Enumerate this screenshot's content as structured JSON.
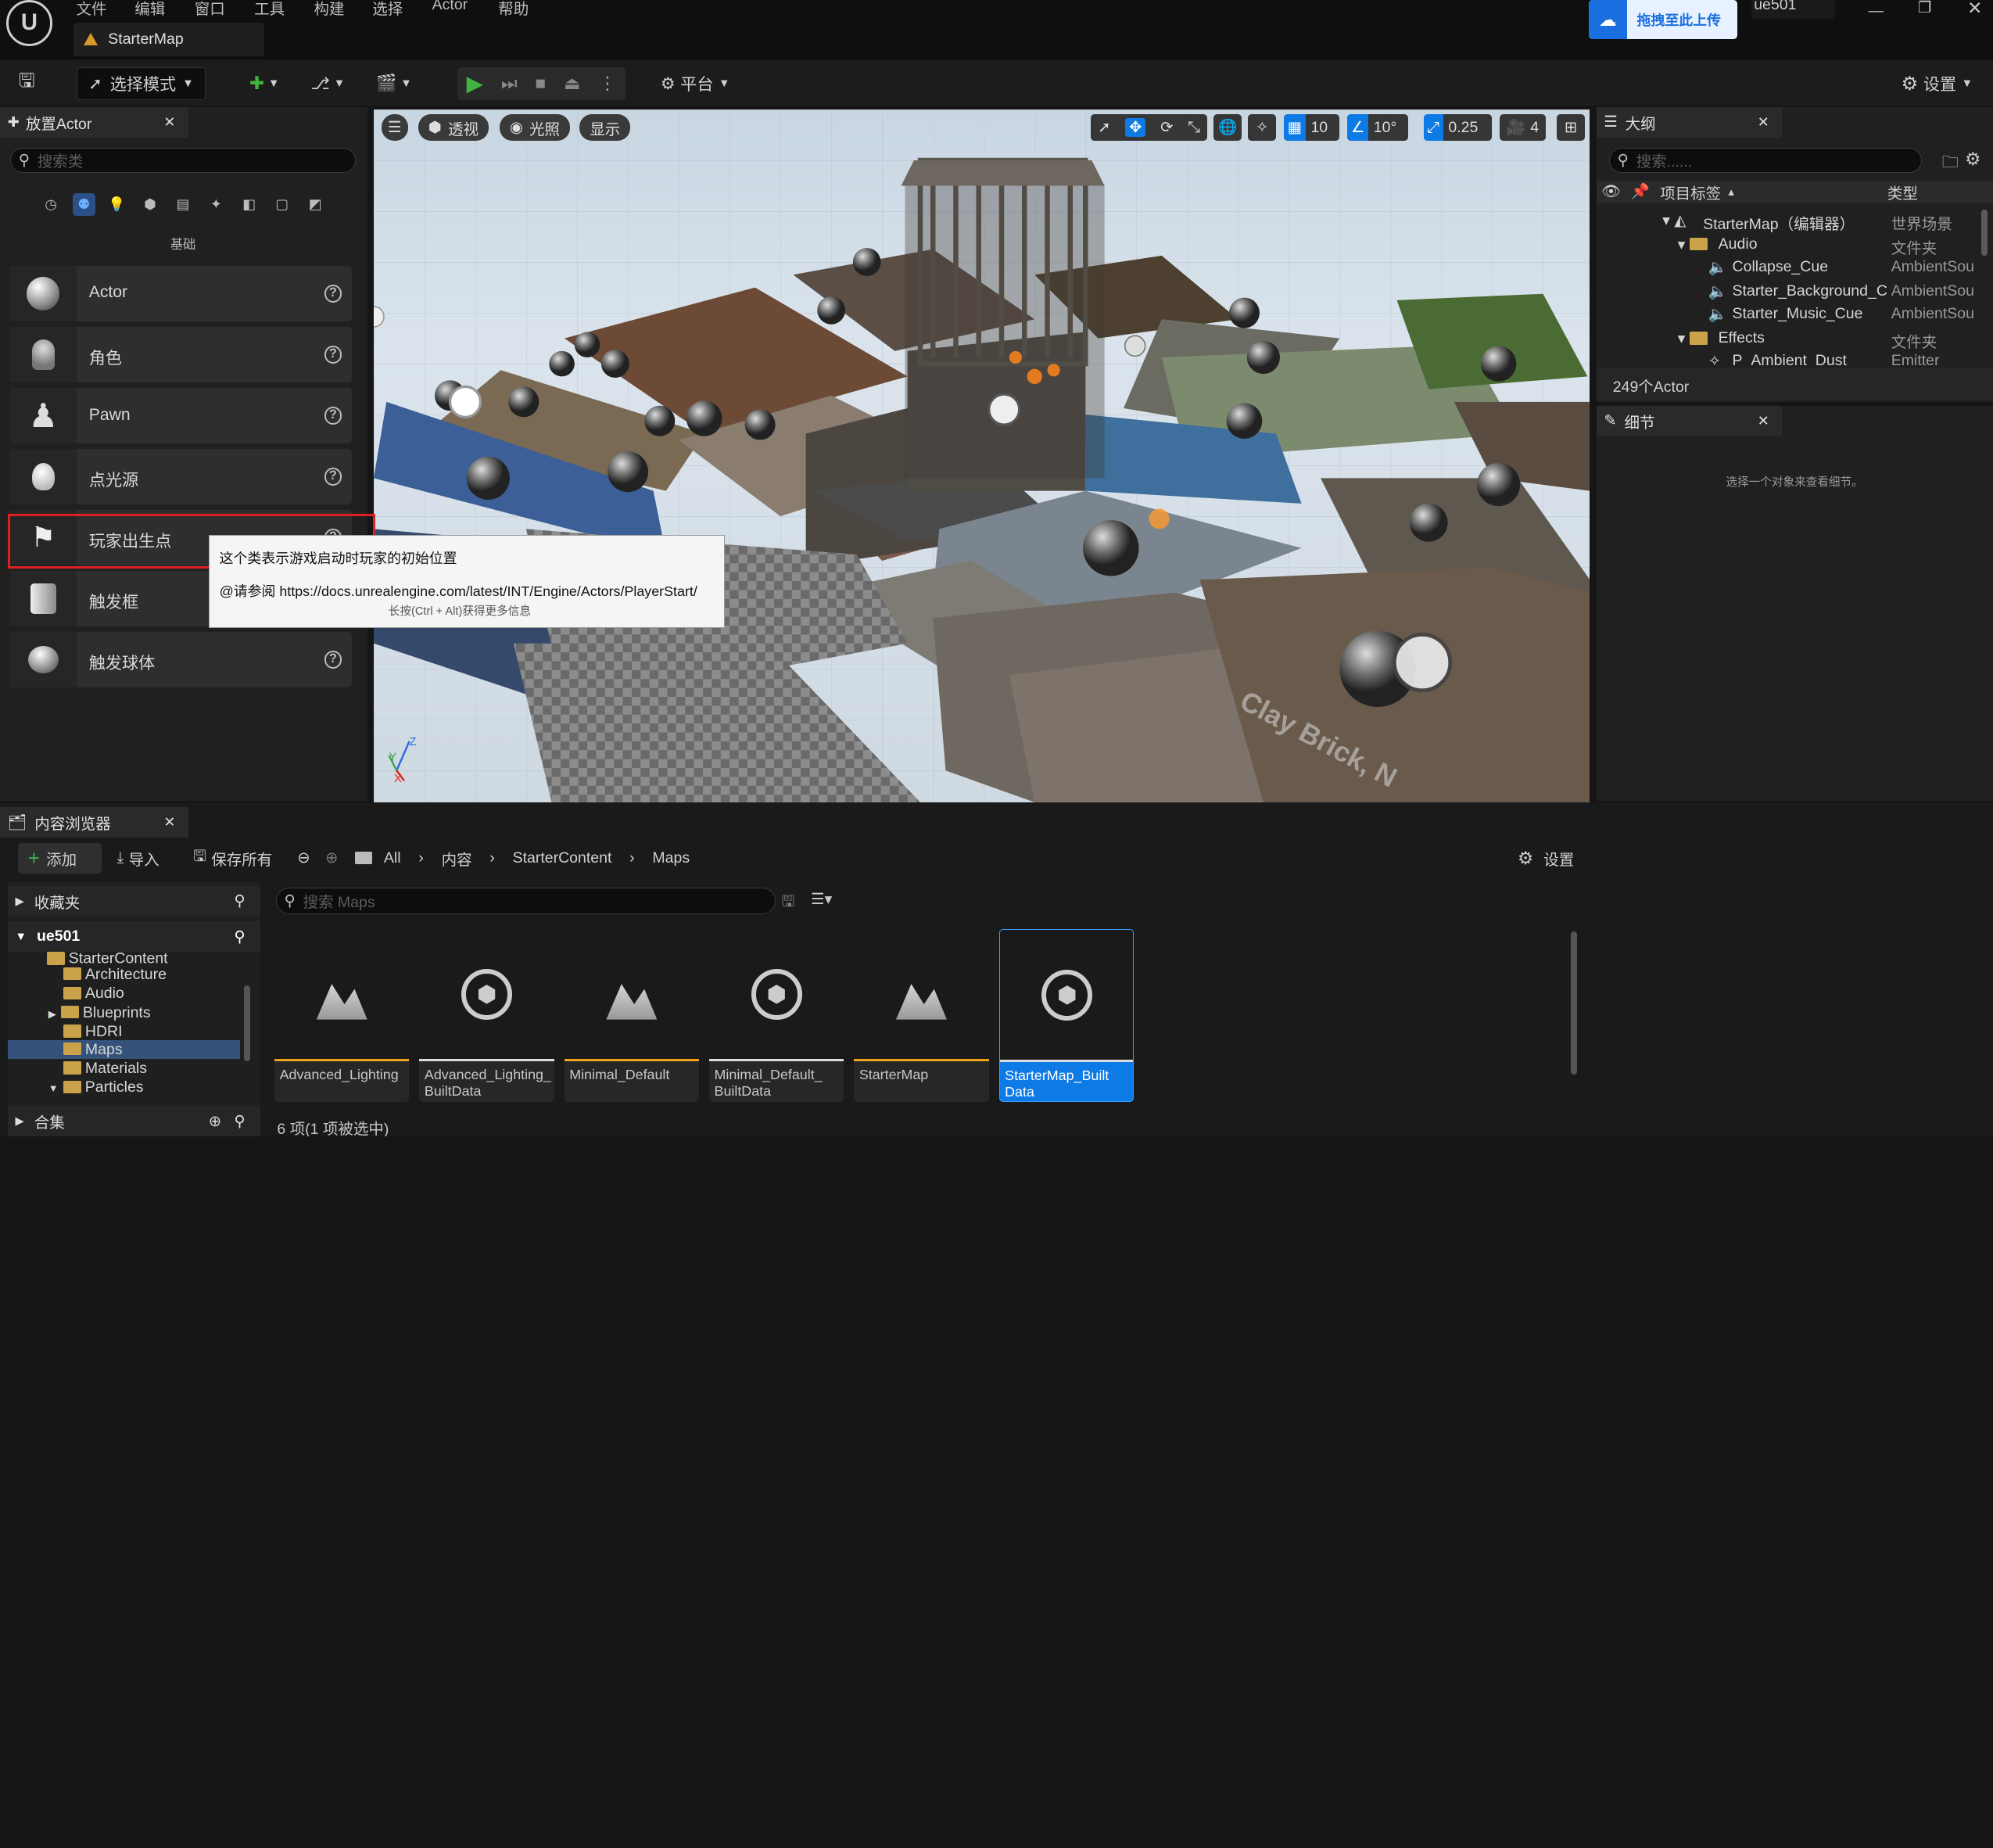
{
  "app": {
    "tab_title": "StarterMap",
    "user": "ue501",
    "upload_label": "拖拽至此上传"
  },
  "menu": [
    "文件",
    "编辑",
    "窗口",
    "工具",
    "构建",
    "选择",
    "Actor",
    "帮助"
  ],
  "toolbar": {
    "select_mode": "选择模式",
    "platform": "平台",
    "settings": "设置"
  },
  "place_actor": {
    "tab": "放置Actor",
    "search_placeholder": "搜索类",
    "category": "基础",
    "items": [
      {
        "label": "Actor",
        "icon": "sphere-icon"
      },
      {
        "label": "角色",
        "icon": "character-icon"
      },
      {
        "label": "Pawn",
        "icon": "pawn-icon"
      },
      {
        "label": "点光源",
        "icon": "bulb-icon"
      },
      {
        "label": "玩家出生点",
        "icon": "player-start-icon"
      },
      {
        "label": "触发框",
        "icon": "trigger-box-icon"
      },
      {
        "label": "触发球体",
        "icon": "trigger-sphere-icon"
      }
    ],
    "tooltip": {
      "line1": "这个类表示游戏启动时玩家的初始位置",
      "line2": "@请参阅 https://docs.unrealengine.com/latest/INT/Engine/Actors/PlayerStart/",
      "line3": "长按(Ctrl + Alt)获得更多信息"
    }
  },
  "viewport": {
    "perspective": "透视",
    "lighting": "光照",
    "show": "显示",
    "grid": "10",
    "angle": "10°",
    "scale": "0.25",
    "camera": "4",
    "floor_text": "Clay Brick, N"
  },
  "outliner": {
    "tab": "大纲",
    "search_placeholder": "搜索......",
    "col_label": "项目标签",
    "col_type": "类型",
    "rows": [
      {
        "name": "StarterMap（编辑器）",
        "type": "世界场景"
      },
      {
        "name": "Audio",
        "type": "文件夹"
      },
      {
        "name": "Collapse_Cue",
        "type": "AmbientSou"
      },
      {
        "name": "Starter_Background_C",
        "type": "AmbientSou"
      },
      {
        "name": "Starter_Music_Cue",
        "type": "AmbientSou"
      },
      {
        "name": "Effects",
        "type": "文件夹"
      },
      {
        "name": "P_Ambient_Dust",
        "type": "Emitter"
      }
    ],
    "count": "249个Actor"
  },
  "details": {
    "tab": "细节",
    "empty": "选择一个对象来查看细节。"
  },
  "content_browser": {
    "tab": "内容浏览器",
    "add": "添加",
    "import": "导入",
    "save_all": "保存所有",
    "settings": "设置",
    "path": [
      "All",
      "内容",
      "StarterContent",
      "Maps"
    ],
    "favorites": "收藏夹",
    "project": "ue501",
    "collections": "合集",
    "tree": [
      "StarterContent",
      "Architecture",
      "Audio",
      "Blueprints",
      "HDRI",
      "Maps",
      "Materials",
      "Particles"
    ],
    "search_placeholder": "搜索 Maps",
    "assets": [
      {
        "name": "Advanced_Lighting",
        "kind": "map"
      },
      {
        "name": "Advanced_Lighting_ BuiltData",
        "kind": "data"
      },
      {
        "name": "Minimal_Default",
        "kind": "map"
      },
      {
        "name": "Minimal_Default_ BuiltData",
        "kind": "data"
      },
      {
        "name": "StarterMap",
        "kind": "map"
      },
      {
        "name": "StarterMap_Built Data",
        "kind": "data",
        "selected": true
      }
    ],
    "status": "6 项(1 项被选中)"
  },
  "colors": {
    "accent": "#0e7ae6",
    "play": "#3fb33f",
    "asset_bar": "#f0a21b",
    "highlight": "#e02020"
  }
}
